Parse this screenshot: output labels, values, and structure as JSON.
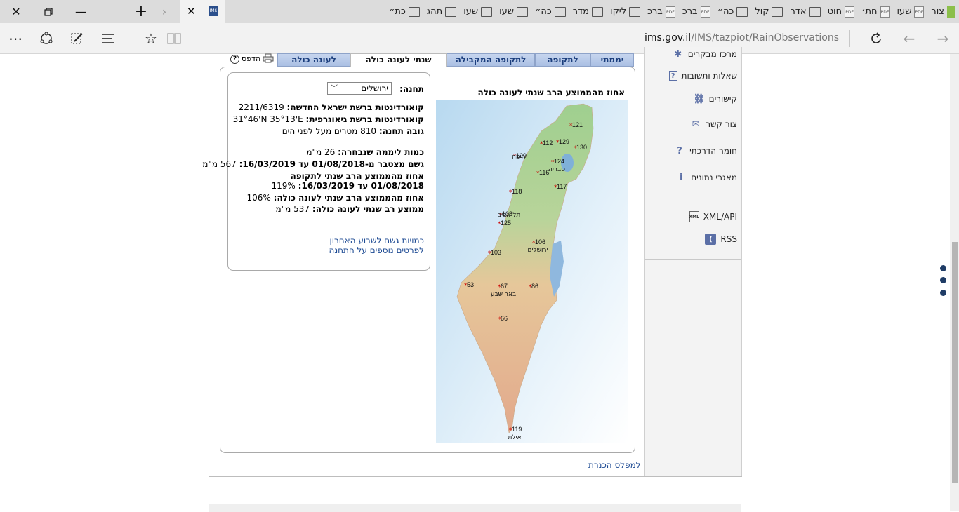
{
  "browser": {
    "tabs": [
      {
        "label": "כת״",
        "icon": "page-icon"
      },
      {
        "label": "תהג",
        "icon": "page-icon"
      },
      {
        "label": "שעו",
        "icon": "page-icon"
      },
      {
        "label": "שעו",
        "icon": "page-icon"
      },
      {
        "label": "כה״",
        "icon": "page-icon"
      },
      {
        "label": "מדר",
        "icon": "page-icon"
      },
      {
        "label": "ליקו",
        "icon": "page-icon"
      },
      {
        "label": "ברכ",
        "icon": "pdf-icon"
      },
      {
        "label": "ברכ",
        "icon": "pdf-icon"
      },
      {
        "label": "כה״",
        "icon": "page-icon"
      },
      {
        "label": "קול",
        "icon": "page-icon"
      },
      {
        "label": "אדר",
        "icon": "page-icon"
      },
      {
        "label": "חוט",
        "icon": "pdf-icon"
      },
      {
        "label": "חת׳",
        "icon": "pdf-icon"
      },
      {
        "label": "שעו",
        "icon": "pdf-icon"
      },
      {
        "label": "צור",
        "icon": "site-icon"
      }
    ],
    "url_domain": "ims.gov.il",
    "url_path": "/IMS/tazpiot/RainObservations"
  },
  "sidebar": {
    "items": [
      {
        "label": "מרכז מבקרים",
        "icon": "visitors-icon"
      },
      {
        "label": "שאלות ותשובות",
        "icon": "faq-icon"
      },
      {
        "label": "קישורים",
        "icon": "links-icon"
      },
      {
        "label": "צור קשר",
        "icon": "mail-icon"
      },
      {
        "label": "חומר הדרכתי",
        "icon": "question-icon"
      },
      {
        "label": "מאגרי נתונים",
        "icon": "info-icon"
      },
      {
        "label": "XML/API",
        "icon": "xml-icon"
      },
      {
        "label": "RSS",
        "icon": "rss-icon"
      }
    ]
  },
  "panel_tabs": [
    {
      "label": "יממתי",
      "active": false
    },
    {
      "label": "לתקופה",
      "active": false
    },
    {
      "label": "לתקופה המקבילה",
      "active": false
    },
    {
      "label": "שנתי לעונה כולה",
      "active": true
    },
    {
      "label": "לעונה כולה",
      "active": false
    }
  ],
  "print_label": "הדפס",
  "help_label": "?",
  "station": {
    "label": "תחנה:",
    "selected": "ירושלים",
    "coords_itm_label": "קואורדינטות ברשת ישראל החדשה:",
    "coords_itm_value": "2211/6319",
    "coords_geo_label": "קואורדינטות ברשת גיאוגרפית:",
    "coords_geo_value": "31°46'N  35°13'E",
    "elevation_label": "גובה תחנה:",
    "elevation_value": "810 מטרים מעל לפני הים",
    "daily_label": "כמות ליממה שנבחרה:",
    "daily_value": "26 מ\"מ",
    "cum_label": "גשם מצטבר מ-01/08/2018 עד 16/03/2019:",
    "cum_value": "567 מ\"מ",
    "pct_period_label": "אחוז מהממוצע הרב שנתי לתקופה 01/08/2018 עד 16/03/2019:",
    "pct_period_value": "119%",
    "pct_season_label": "אחוז מהממוצע הרב שנתי לעונה כולה:",
    "pct_season_value": "106%",
    "avg_season_label": "ממוצע רב שנתי לעונה כולה:",
    "avg_season_value": "537 מ\"מ",
    "link_week": "כמויות גשם לשבוע האחרון",
    "link_more": "לפרטים נוספים על התחנה"
  },
  "map": {
    "title": "אחוז מהממוצע הרב שנתי לעונה כולה",
    "colors": {
      "sea": "#cfe6f6",
      "land_north": "#9fcf8f",
      "land_south": "#e8b895",
      "lake": "#7fb0d8"
    },
    "labels": [
      {
        "value": "121",
        "city": ""
      },
      {
        "value": "129",
        "city": ""
      },
      {
        "value": "130",
        "city": ""
      },
      {
        "value": "112",
        "city": ""
      },
      {
        "value": "129",
        "city": "חיפה"
      },
      {
        "value": "124",
        "city": "טבריה"
      },
      {
        "value": "116",
        "city": ""
      },
      {
        "value": "117",
        "city": ""
      },
      {
        "value": "118",
        "city": ""
      },
      {
        "value": "108",
        "city": "תל אביב"
      },
      {
        "value": "125",
        "city": ""
      },
      {
        "value": "106",
        "city": "ירושלים"
      },
      {
        "value": "103",
        "city": ""
      },
      {
        "value": "53",
        "city": ""
      },
      {
        "value": "67",
        "city": "באר שבע"
      },
      {
        "value": "86",
        "city": ""
      },
      {
        "value": "66",
        "city": ""
      },
      {
        "value": "119",
        "city": "אילת"
      }
    ]
  },
  "kinneret_link": "למפלס הכנרת"
}
